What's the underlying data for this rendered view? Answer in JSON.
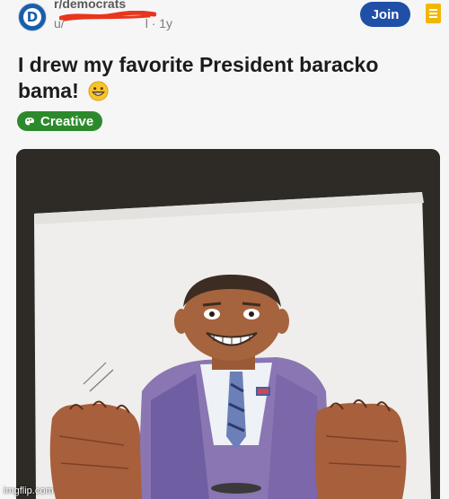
{
  "post": {
    "subreddit": "r/democrats",
    "user_prefix": "u/",
    "user_suffix": "l",
    "age": "· 1y",
    "join_label": "Join",
    "title": "I drew my favorite President baracko bama!",
    "flair": "Creative",
    "emoji_icon": "grinning-face-icon"
  },
  "subreddit_icon": {
    "letter": "D",
    "color": "#1a5ea8"
  },
  "colors": {
    "join": "#1f4fa6",
    "flair": "#2d8a2c",
    "menu": "#f3b600",
    "redaction": "#e8361d"
  },
  "watermark": "imgflip.com"
}
